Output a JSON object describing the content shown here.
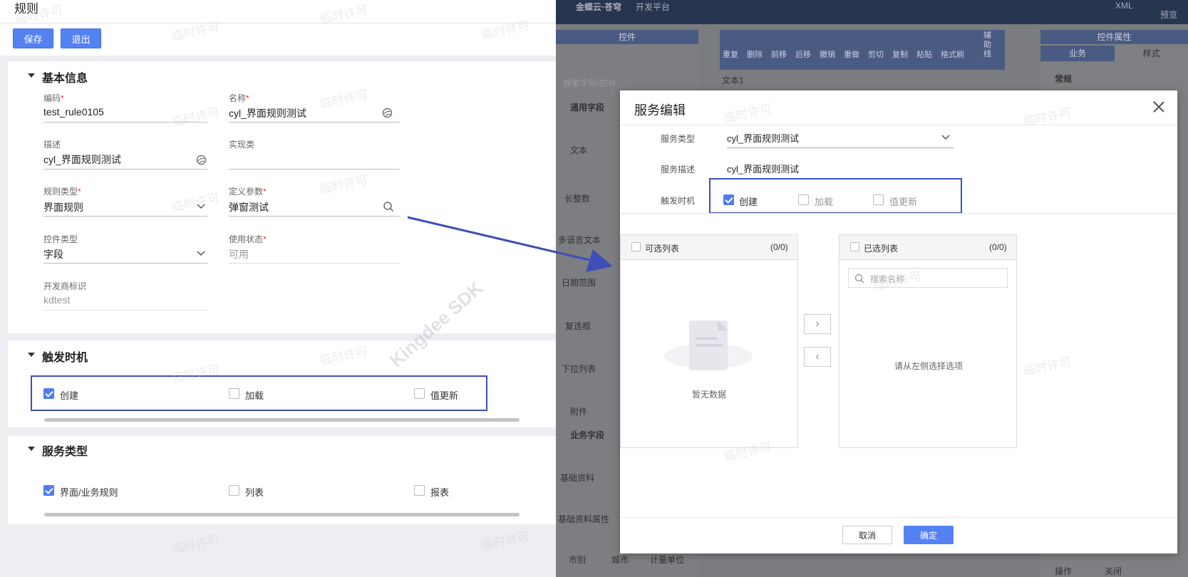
{
  "left": {
    "title": "规则",
    "buttons": {
      "save": "保存",
      "exit": "退出"
    },
    "basic": {
      "title": "基本信息",
      "code": {
        "label": "编码",
        "value": "test_rule0105"
      },
      "name": {
        "label": "名称",
        "value": "cyl_界面规则测试"
      },
      "desc": {
        "label": "描述",
        "value": "cyl_界面规则测试"
      },
      "impl": {
        "label": "实现类",
        "value": ""
      },
      "ruletype": {
        "label": "规则类型",
        "value": "界面规则"
      },
      "params": {
        "label": "定义参数",
        "value": "弹窗测试"
      },
      "ctrltype": {
        "label": "控件类型",
        "value": "字段"
      },
      "status": {
        "label": "使用状态",
        "value": "可用"
      },
      "dev": {
        "label": "开发商标识",
        "value": "kdtest"
      }
    },
    "trigger": {
      "title": "触发时机",
      "create": "创建",
      "load": "加载",
      "update": "值更新"
    },
    "service": {
      "title": "服务类型",
      "ui": "界面/业务规则",
      "list": "列表",
      "report": "报表"
    }
  },
  "bg": {
    "brand": "金蝶云·苍穹",
    "platform": "开发平台",
    "xml": "XML",
    "preview": "预览",
    "ctrl_panel": "控件",
    "ctrl_props": "控件属性",
    "tab_business": "业务",
    "tab_style": "样式",
    "general": "常规",
    "search_ph": "搜索字段/控件",
    "common_fields": "通用字段",
    "biz_fields": "业务字段",
    "text1": "文本1",
    "toolbar": [
      "重复",
      "删除",
      "前移",
      "后移",
      "撤销",
      "重做",
      "剪切",
      "复制",
      "粘贴",
      "格式刷"
    ],
    "aux": "辅助线",
    "fields": [
      "文本",
      "长整数",
      "多语言文本",
      "日期范围",
      "复选框",
      "下拉列表",
      "附件",
      "基础资料",
      "基础资料属性",
      "市别",
      "城市",
      "计量单位"
    ],
    "op_label": "操作",
    "op_value": "关闭"
  },
  "modal": {
    "title": "服务编辑",
    "svc_type_label": "服务类型",
    "svc_type_value": "cyl_界面规则测试",
    "svc_desc_label": "服务描述",
    "svc_desc_value": "cyl_界面规则测试",
    "trigger_label": "触发时机",
    "create": "创建",
    "load": "加载",
    "update": "值更新",
    "avail_title": "可选列表",
    "avail_count": "(0/0)",
    "sel_title": "已选列表",
    "sel_count": "(0/0)",
    "search_ph": "搜索名称",
    "empty": "暂无数据",
    "hint": "请从左侧选择选项",
    "cancel": "取消",
    "ok": "确定"
  },
  "watermark": {
    "text": "临时许可",
    "sdk": "Kingdee SDK"
  }
}
